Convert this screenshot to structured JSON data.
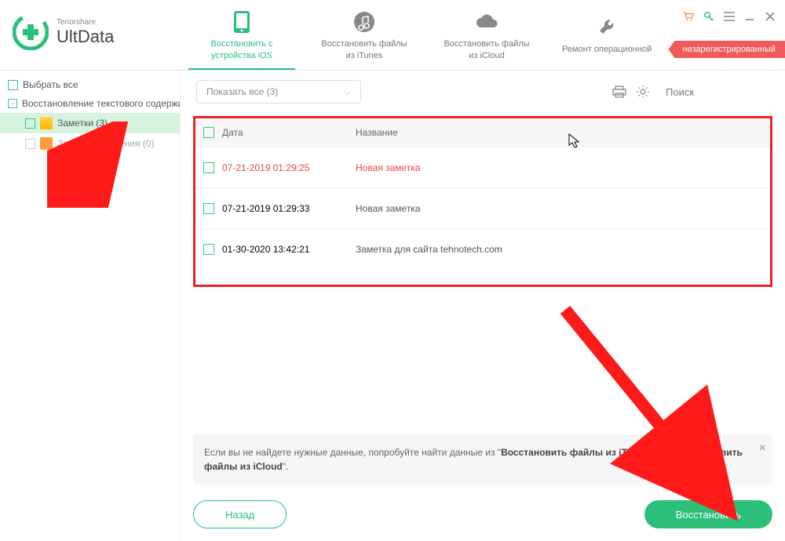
{
  "brand": {
    "company": "Tenorshare",
    "product": "UltData"
  },
  "tabs": [
    {
      "label": "Восстановить с устройства iOS",
      "icon": "phone",
      "active": true
    },
    {
      "label": "Восстановить файлы из iTunes",
      "icon": "itunes",
      "active": false
    },
    {
      "label": "Восстановить файлы из iCloud",
      "icon": "cloud",
      "active": false
    },
    {
      "label": "Ремонт операционной",
      "icon": "wrench",
      "active": false
    }
  ],
  "ribbon": "незарегистрированный",
  "sidebar": {
    "select_all": "Выбрать все",
    "group": "Восстановление текстового содержимо",
    "items": [
      {
        "label": "Заметки (3)",
        "icon": "notes",
        "selected": true,
        "dim": false
      },
      {
        "label": "Заметки Вложения (0)",
        "icon": "attach",
        "selected": false,
        "dim": true
      }
    ]
  },
  "toolbar": {
    "dropdown": "Показать все  (3)",
    "search_placeholder": "Поиск"
  },
  "table": {
    "headers": {
      "date": "Дата",
      "name": "Название"
    },
    "rows": [
      {
        "date": "07-21-2019 01:29:25",
        "name": "Новая заметка",
        "deleted": true
      },
      {
        "date": "07-21-2019 01:29:33",
        "name": "Новая заметка",
        "deleted": false
      },
      {
        "date": "01-30-2020 13:42:21",
        "name": "Заметка для сайта tehnotech.com",
        "deleted": false
      }
    ]
  },
  "hint": {
    "prefix": "Если вы не найдете нужные данные, попробуйте найти данные из \"",
    "bold1": "Восстановить файлы из iTunes",
    "mid": "\" или \"",
    "bold2": "Восстановить файлы из iCloud",
    "suffix": "\"."
  },
  "footer": {
    "back": "Назад",
    "recover": "Восстановить"
  }
}
